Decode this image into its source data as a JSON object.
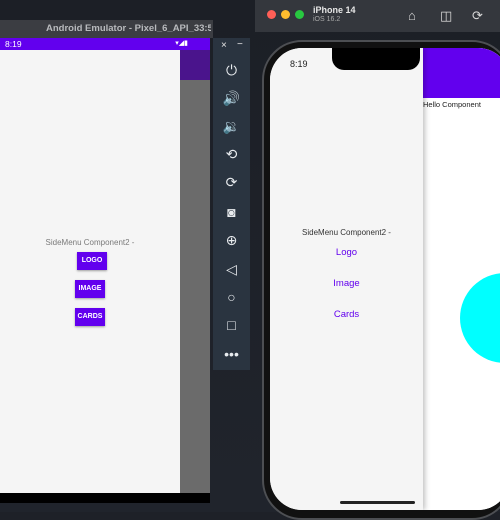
{
  "android": {
    "window_title": "Android Emulator - Pixel_6_API_33:5...",
    "time": "8:19",
    "label": "SideMenu Component2 -",
    "buttons": [
      "LOGO",
      "IMAGE",
      "CARDS"
    ],
    "toolbar_icons": [
      "power-icon",
      "volume-up-icon",
      "volume-down-icon",
      "rotate-left-icon",
      "rotate-right-icon",
      "camera-icon",
      "zoom-in-icon",
      "back-icon",
      "home-icon",
      "overview-icon",
      "more-icon"
    ]
  },
  "ios": {
    "device": "iPhone 14",
    "os": "iOS 16.2",
    "time": "8:19",
    "label": "SideMenu Component2 -",
    "links": [
      "Logo",
      "Image",
      "Cards"
    ],
    "content_text": "Hello Component"
  },
  "colors": {
    "accent": "#6200ee",
    "cyan": "#00ffff"
  }
}
